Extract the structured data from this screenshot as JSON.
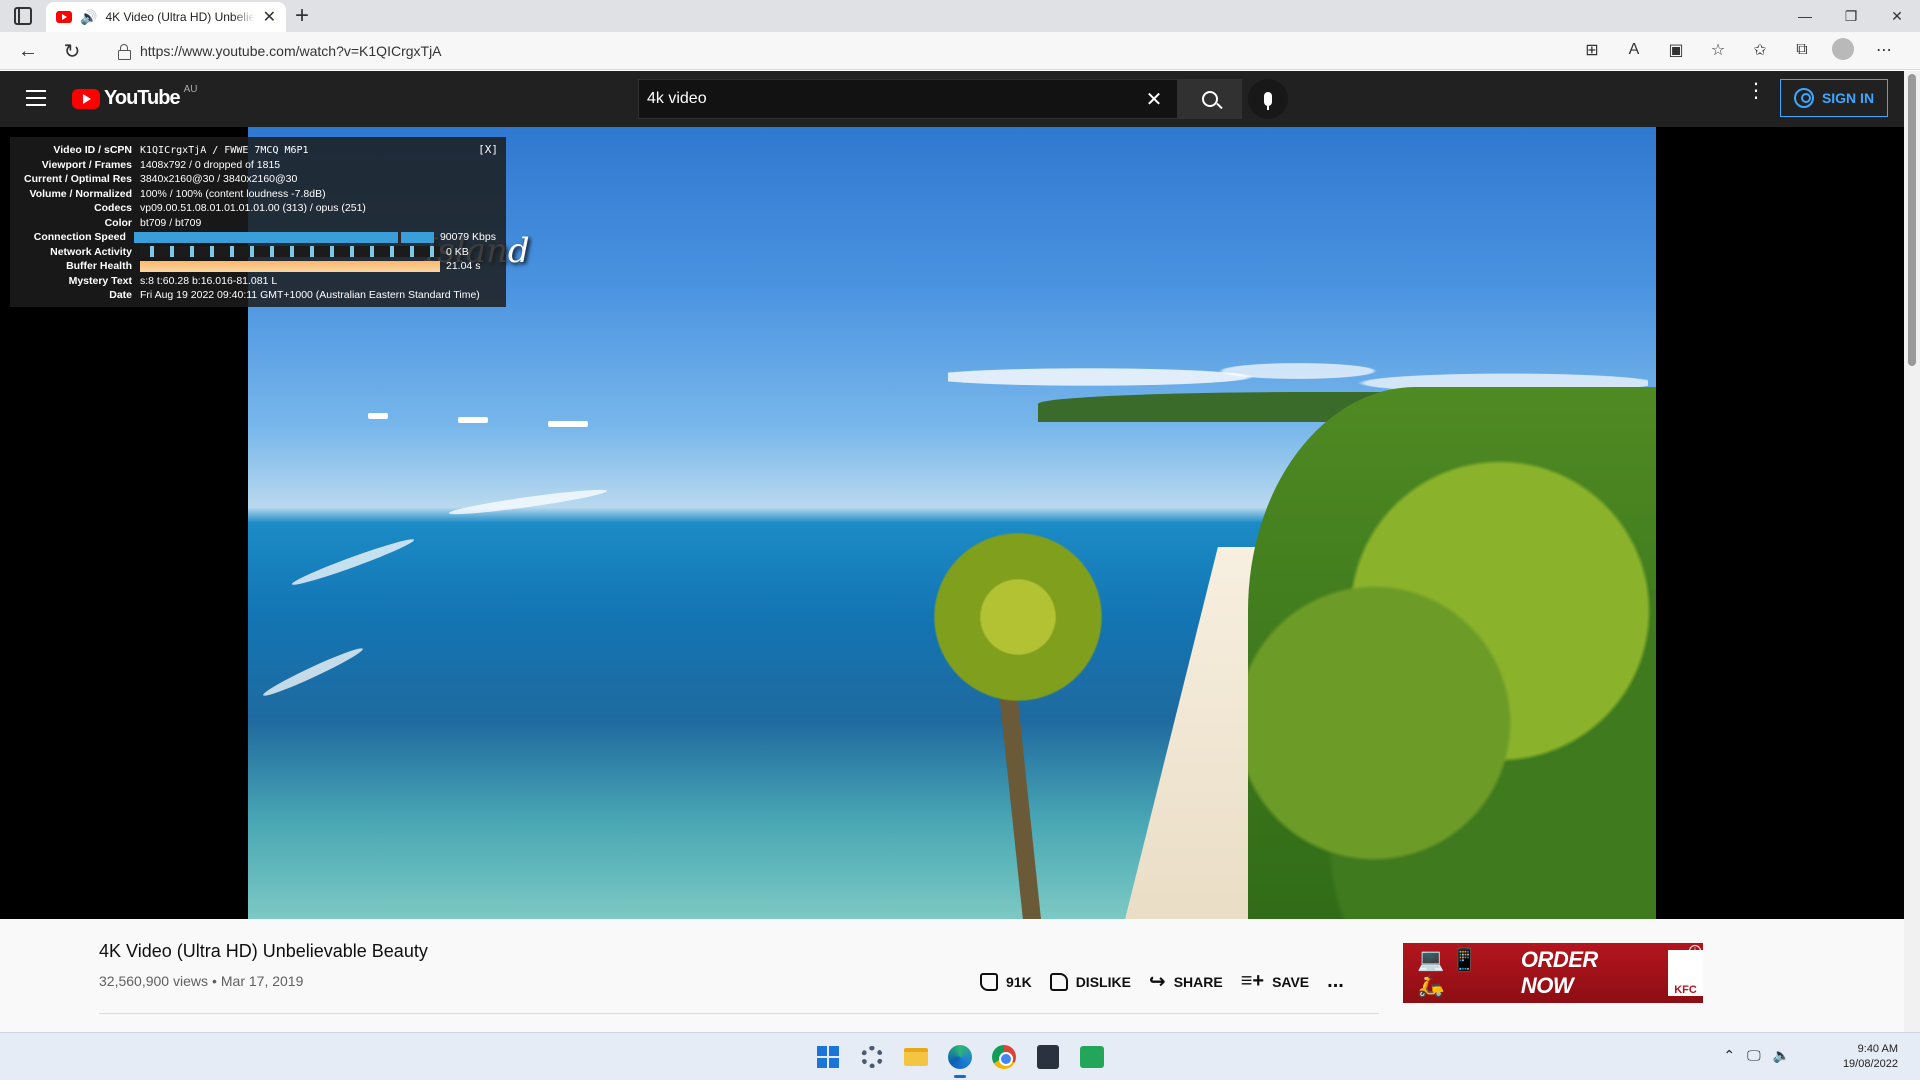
{
  "browser": {
    "tab_title": "4K Video (Ultra HD) Unbelie",
    "tab_close": "✕",
    "new_tab": "+",
    "url": "https://www.youtube.com/watch?v=K1QICrgxTjA",
    "window_controls": {
      "minimize": "—",
      "maximize": "❐",
      "close": "✕"
    }
  },
  "youtube": {
    "wordmark": "YouTube",
    "region": "AU",
    "search": {
      "value": "4k video",
      "clear": "✕"
    },
    "more": "⋮",
    "sign_in": "SIGN IN"
  },
  "video": {
    "overlay_text": "Island"
  },
  "stats_for_nerds": {
    "close": "[X]",
    "rows": [
      {
        "label": "Video ID / sCPN",
        "value": "K1QICrgxTjA / FWWE 7MCQ M6P1"
      },
      {
        "label": "Viewport / Frames",
        "value": "1408x792 / 0 dropped of 1815"
      },
      {
        "label": "Current / Optimal Res",
        "value": "3840x2160@30 / 3840x2160@30"
      },
      {
        "label": "Volume / Normalized",
        "value": "100% / 100% (content loudness -7.8dB)"
      },
      {
        "label": "Codecs",
        "value": "vp09.00.51.08.01.01.01.01.00 (313) / opus (251)"
      },
      {
        "label": "Color",
        "value": "bt709 / bt709"
      },
      {
        "label": "Connection Speed",
        "value": "90079 Kbps"
      },
      {
        "label": "Network Activity",
        "value": "0 KB"
      },
      {
        "label": "Buffer Health",
        "value": "21.04 s"
      },
      {
        "label": "Mystery Text",
        "value": "s:8 t:60.28 b:16.016-81.081 L"
      },
      {
        "label": "Date",
        "value": "Fri Aug 19 2022 09:40:11 GMT+1000 (Australian Eastern Standard Time)"
      }
    ]
  },
  "details": {
    "title": "4K Video (Ultra HD) Unbelievable Beauty",
    "views": "32,560,900 views",
    "separator": "•",
    "date": "Mar 17, 2019",
    "likes": "91K",
    "dislike": "DISLIKE",
    "share": "SHARE",
    "save": "SAVE",
    "more": "..."
  },
  "ad": {
    "cta": "ORDER NOW",
    "brand": "KFC",
    "info": "i"
  },
  "taskbar": {
    "time": "9:40 AM",
    "date": "19/08/2022"
  },
  "colors": {
    "youtube_red": "#ff0000",
    "header_bg": "#212121",
    "sign_in_blue": "#3ea6ff",
    "ad_red": "#b3151d"
  }
}
